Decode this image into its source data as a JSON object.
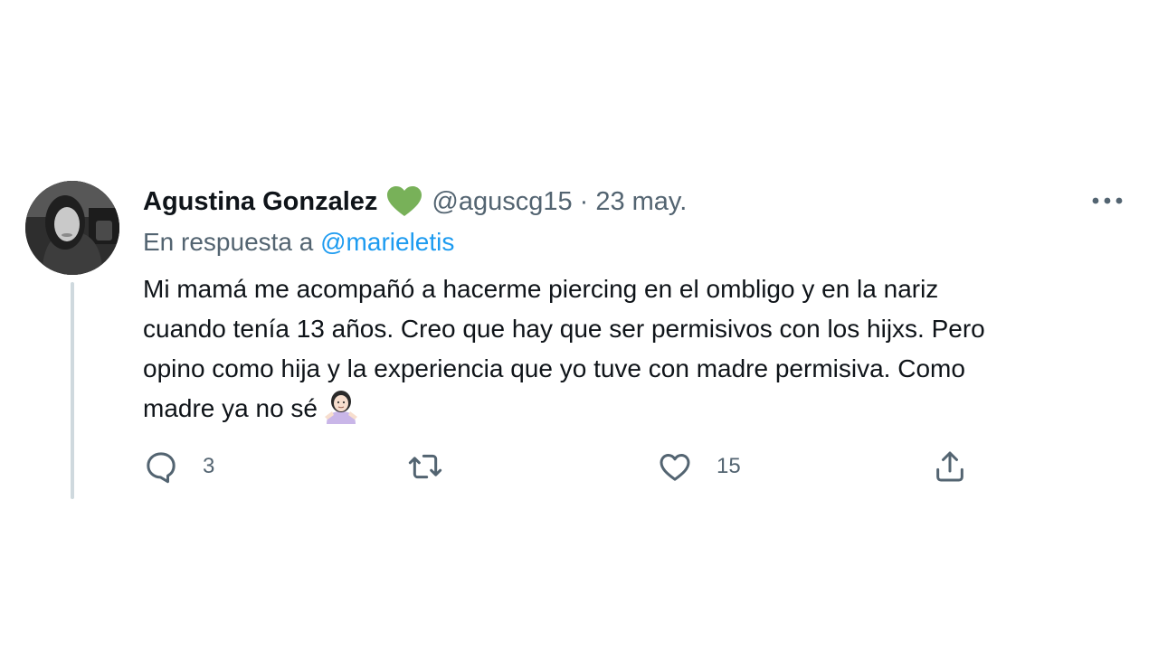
{
  "tweet": {
    "author": {
      "display_name": "Agustina Gonzalez",
      "badge": "green-heart-icon",
      "handle": "@aguscg15",
      "separator": "·",
      "date": "23 may."
    },
    "reply_context": {
      "prefix": "En respuesta a",
      "mention": "@marieletis"
    },
    "body_lines": [
      "Mi mamá me acompañó a hacerme piercing en el ombligo y en la nariz",
      "cuando tenía 13 años. Creo que hay que ser permisivos con los hijxs. Pero",
      "opino como hija y la experiencia que yo tuve con madre permisiva. Como",
      "madre ya no sé"
    ],
    "body_emoji": "person-shrugging-emoji",
    "actions": {
      "reply": {
        "icon": "reply-icon",
        "count": "3"
      },
      "retweet": {
        "icon": "retweet-icon",
        "count": ""
      },
      "like": {
        "icon": "heart-icon",
        "count": "15"
      },
      "share": {
        "icon": "share-icon",
        "count": ""
      }
    },
    "more_icon": "more-horizontal-icon",
    "colors": {
      "text": "#0f1419",
      "secondary": "#536471",
      "link": "#1d9bf0",
      "badge": "#78b159",
      "thread_line": "#cfd9de"
    }
  }
}
